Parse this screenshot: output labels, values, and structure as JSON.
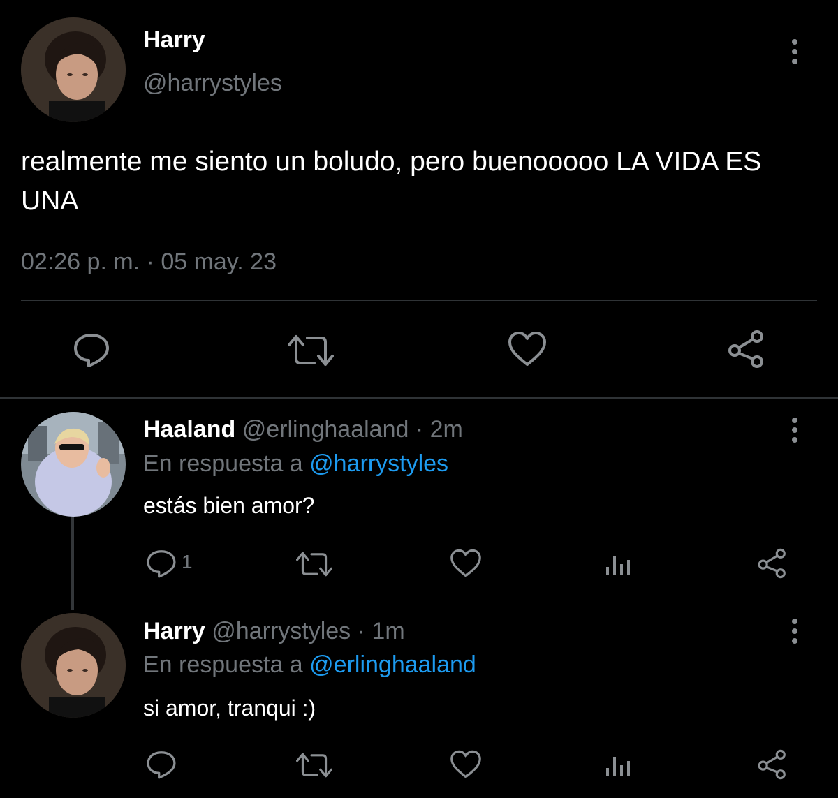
{
  "main_tweet": {
    "author_name": "Harry",
    "author_handle": "@harrystyles",
    "text": "realmente me siento un boludo, pero buenooooo LA VIDA ES UNA",
    "timestamp": "02:26 p. m. · 05 may. 23",
    "actions": [
      "reply-icon",
      "retweet-icon",
      "like-icon",
      "share-icon"
    ]
  },
  "replies": [
    {
      "author_name": "Haaland",
      "author_handle": "@erlinghaaland",
      "time": "· 2m",
      "reply_to_prefix": "En respuesta a",
      "reply_to_handle": "@harrystyles",
      "text": "estás bien amor?",
      "reply_count": "1"
    },
    {
      "author_name": "Harry",
      "author_handle": "@harrystyles",
      "time": "· 1m",
      "reply_to_prefix": "En respuesta a",
      "reply_to_handle": "@erlinghaaland",
      "text": "si amor, tranqui :)",
      "reply_count": ""
    }
  ],
  "colors": {
    "background": "#000000",
    "text": "#ffffff",
    "muted": "#71767b",
    "link": "#1d9bf0",
    "divider": "#2f3336"
  }
}
